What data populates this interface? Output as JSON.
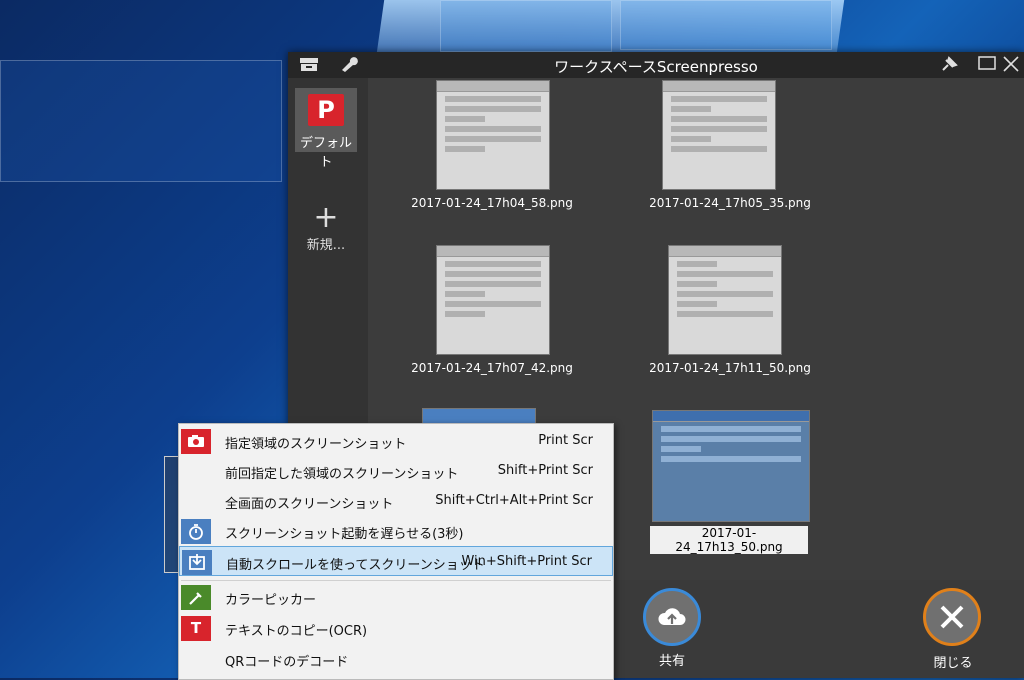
{
  "window": {
    "title": "ワークスペースScreenpresso"
  },
  "sidebar": {
    "default_workspace": {
      "logo_letter": "P",
      "label": "デフォルト"
    },
    "new_workspace": {
      "label": "新規..."
    }
  },
  "gallery": {
    "files": [
      "2017-01-24_17h04_58.png",
      "2017-01-24_17h05_35.png",
      "2017-01-24_17h07_42.png",
      "2017-01-24_17h11_50.png",
      "2017-01-24_17h13_50.png"
    ]
  },
  "bottombar": {
    "share_label": "共有",
    "close_label": "閉じる"
  },
  "context_menu": {
    "items": [
      {
        "label": "指定領域のスクリーンショット",
        "shortcut": "Print Scr"
      },
      {
        "label": "前回指定した領域のスクリーンショット",
        "shortcut": "Shift+Print Scr"
      },
      {
        "label": "全画面のスクリーンショット",
        "shortcut": "Shift+Ctrl+Alt+Print Scr"
      },
      {
        "label": "スクリーンショット起動を遅らせる(3秒)",
        "shortcut": ""
      },
      {
        "label": "自動スクロールを使ってスクリーンショット",
        "shortcut": "Win+Shift+Print Scr"
      },
      {
        "label": "カラーピッカー",
        "shortcut": ""
      },
      {
        "label": "テキストのコピー(OCR)",
        "shortcut": ""
      },
      {
        "label": "QRコードのデコード",
        "shortcut": ""
      }
    ],
    "ocr_icon_letter": "T"
  },
  "colors": {
    "accent_red": "#d8242c",
    "accent_blue": "#4a7fc0",
    "accent_green": "#4a8a2a",
    "highlight_bg": "#cce4f7",
    "share_ring": "#3a8ad8",
    "close_ring": "#e0801a"
  }
}
